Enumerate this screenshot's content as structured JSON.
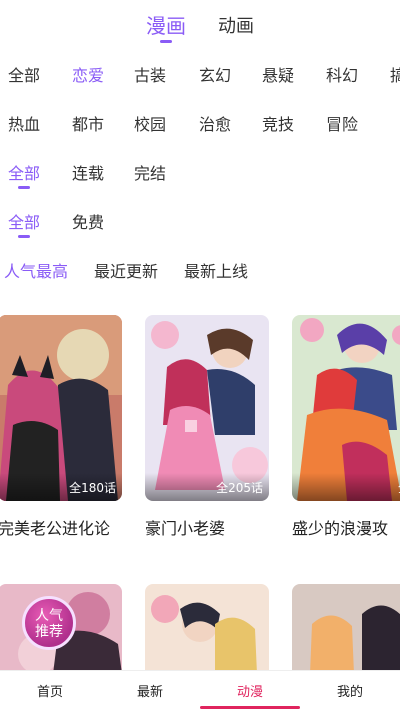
{
  "top_tabs": [
    {
      "label": "漫画",
      "active": true
    },
    {
      "label": "动画",
      "active": false
    }
  ],
  "genres_row1": [
    "全部",
    "恋爱",
    "古装",
    "玄幻",
    "悬疑",
    "科幻",
    "搞"
  ],
  "genres_row1_active": "恋爱",
  "genres_row2": [
    "热血",
    "都市",
    "校园",
    "治愈",
    "竞技",
    "冒险"
  ],
  "status_filters": [
    "全部",
    "连载",
    "完结"
  ],
  "status_active": "全部",
  "price_filters": [
    "全部",
    "免费"
  ],
  "price_active": "全部",
  "sort_options": [
    "人气最高",
    "最近更新",
    "最新上线"
  ],
  "sort_active": "人气最高",
  "cards": [
    {
      "title": "完美老公进化论",
      "count": "全180话"
    },
    {
      "title": "豪门小老婆",
      "count": "全205话"
    },
    {
      "title": "盛少的浪漫攻",
      "count": "全"
    }
  ],
  "badge": {
    "line1": "人气",
    "line2": "推荐"
  },
  "bottom_nav": [
    "首页",
    "最新",
    "动漫",
    "我的"
  ],
  "bottom_nav_active": "动漫",
  "colors": {
    "accent": "#8a5cf6",
    "nav_active": "#e0245e"
  }
}
